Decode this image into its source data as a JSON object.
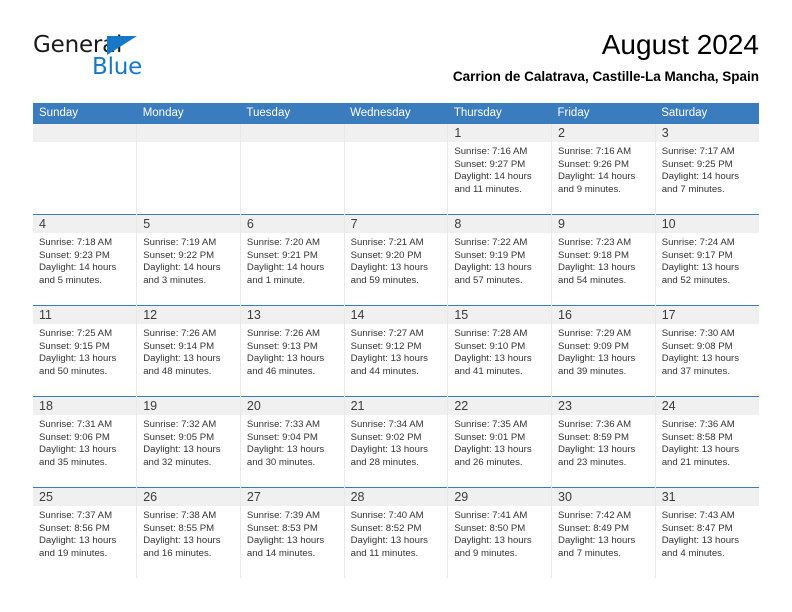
{
  "brand": {
    "name_top": "General",
    "name_bottom": "Blue",
    "triangle_color": "#1878c8",
    "text_color": "#1a1a1a"
  },
  "header": {
    "title": "August 2024",
    "subtitle": "Carrion de Calatrava, Castille-La Mancha, Spain"
  },
  "theme": {
    "header_bar": "#3a7cbd",
    "day_strip": "#f0f0f0",
    "row_divider": "#3a7cbd",
    "cell_text": "#333333"
  },
  "calendar": {
    "weekday_headers": [
      "Sunday",
      "Monday",
      "Tuesday",
      "Wednesday",
      "Thursday",
      "Friday",
      "Saturday"
    ],
    "labels": {
      "sunrise": "Sunrise:",
      "sunset": "Sunset:",
      "daylight": "Daylight:"
    },
    "weeks": [
      [
        {
          "day": "",
          "sunrise": "",
          "sunset": "",
          "daylight_1": "",
          "daylight_2": ""
        },
        {
          "day": "",
          "sunrise": "",
          "sunset": "",
          "daylight_1": "",
          "daylight_2": ""
        },
        {
          "day": "",
          "sunrise": "",
          "sunset": "",
          "daylight_1": "",
          "daylight_2": ""
        },
        {
          "day": "",
          "sunrise": "",
          "sunset": "",
          "daylight_1": "",
          "daylight_2": ""
        },
        {
          "day": "1",
          "sunrise": "Sunrise: 7:16 AM",
          "sunset": "Sunset: 9:27 PM",
          "daylight_1": "Daylight: 14 hours",
          "daylight_2": "and 11 minutes."
        },
        {
          "day": "2",
          "sunrise": "Sunrise: 7:16 AM",
          "sunset": "Sunset: 9:26 PM",
          "daylight_1": "Daylight: 14 hours",
          "daylight_2": "and 9 minutes."
        },
        {
          "day": "3",
          "sunrise": "Sunrise: 7:17 AM",
          "sunset": "Sunset: 9:25 PM",
          "daylight_1": "Daylight: 14 hours",
          "daylight_2": "and 7 minutes."
        }
      ],
      [
        {
          "day": "4",
          "sunrise": "Sunrise: 7:18 AM",
          "sunset": "Sunset: 9:23 PM",
          "daylight_1": "Daylight: 14 hours",
          "daylight_2": "and 5 minutes."
        },
        {
          "day": "5",
          "sunrise": "Sunrise: 7:19 AM",
          "sunset": "Sunset: 9:22 PM",
          "daylight_1": "Daylight: 14 hours",
          "daylight_2": "and 3 minutes."
        },
        {
          "day": "6",
          "sunrise": "Sunrise: 7:20 AM",
          "sunset": "Sunset: 9:21 PM",
          "daylight_1": "Daylight: 14 hours",
          "daylight_2": "and 1 minute."
        },
        {
          "day": "7",
          "sunrise": "Sunrise: 7:21 AM",
          "sunset": "Sunset: 9:20 PM",
          "daylight_1": "Daylight: 13 hours",
          "daylight_2": "and 59 minutes."
        },
        {
          "day": "8",
          "sunrise": "Sunrise: 7:22 AM",
          "sunset": "Sunset: 9:19 PM",
          "daylight_1": "Daylight: 13 hours",
          "daylight_2": "and 57 minutes."
        },
        {
          "day": "9",
          "sunrise": "Sunrise: 7:23 AM",
          "sunset": "Sunset: 9:18 PM",
          "daylight_1": "Daylight: 13 hours",
          "daylight_2": "and 54 minutes."
        },
        {
          "day": "10",
          "sunrise": "Sunrise: 7:24 AM",
          "sunset": "Sunset: 9:17 PM",
          "daylight_1": "Daylight: 13 hours",
          "daylight_2": "and 52 minutes."
        }
      ],
      [
        {
          "day": "11",
          "sunrise": "Sunrise: 7:25 AM",
          "sunset": "Sunset: 9:15 PM",
          "daylight_1": "Daylight: 13 hours",
          "daylight_2": "and 50 minutes."
        },
        {
          "day": "12",
          "sunrise": "Sunrise: 7:26 AM",
          "sunset": "Sunset: 9:14 PM",
          "daylight_1": "Daylight: 13 hours",
          "daylight_2": "and 48 minutes."
        },
        {
          "day": "13",
          "sunrise": "Sunrise: 7:26 AM",
          "sunset": "Sunset: 9:13 PM",
          "daylight_1": "Daylight: 13 hours",
          "daylight_2": "and 46 minutes."
        },
        {
          "day": "14",
          "sunrise": "Sunrise: 7:27 AM",
          "sunset": "Sunset: 9:12 PM",
          "daylight_1": "Daylight: 13 hours",
          "daylight_2": "and 44 minutes."
        },
        {
          "day": "15",
          "sunrise": "Sunrise: 7:28 AM",
          "sunset": "Sunset: 9:10 PM",
          "daylight_1": "Daylight: 13 hours",
          "daylight_2": "and 41 minutes."
        },
        {
          "day": "16",
          "sunrise": "Sunrise: 7:29 AM",
          "sunset": "Sunset: 9:09 PM",
          "daylight_1": "Daylight: 13 hours",
          "daylight_2": "and 39 minutes."
        },
        {
          "day": "17",
          "sunrise": "Sunrise: 7:30 AM",
          "sunset": "Sunset: 9:08 PM",
          "daylight_1": "Daylight: 13 hours",
          "daylight_2": "and 37 minutes."
        }
      ],
      [
        {
          "day": "18",
          "sunrise": "Sunrise: 7:31 AM",
          "sunset": "Sunset: 9:06 PM",
          "daylight_1": "Daylight: 13 hours",
          "daylight_2": "and 35 minutes."
        },
        {
          "day": "19",
          "sunrise": "Sunrise: 7:32 AM",
          "sunset": "Sunset: 9:05 PM",
          "daylight_1": "Daylight: 13 hours",
          "daylight_2": "and 32 minutes."
        },
        {
          "day": "20",
          "sunrise": "Sunrise: 7:33 AM",
          "sunset": "Sunset: 9:04 PM",
          "daylight_1": "Daylight: 13 hours",
          "daylight_2": "and 30 minutes."
        },
        {
          "day": "21",
          "sunrise": "Sunrise: 7:34 AM",
          "sunset": "Sunset: 9:02 PM",
          "daylight_1": "Daylight: 13 hours",
          "daylight_2": "and 28 minutes."
        },
        {
          "day": "22",
          "sunrise": "Sunrise: 7:35 AM",
          "sunset": "Sunset: 9:01 PM",
          "daylight_1": "Daylight: 13 hours",
          "daylight_2": "and 26 minutes."
        },
        {
          "day": "23",
          "sunrise": "Sunrise: 7:36 AM",
          "sunset": "Sunset: 8:59 PM",
          "daylight_1": "Daylight: 13 hours",
          "daylight_2": "and 23 minutes."
        },
        {
          "day": "24",
          "sunrise": "Sunrise: 7:36 AM",
          "sunset": "Sunset: 8:58 PM",
          "daylight_1": "Daylight: 13 hours",
          "daylight_2": "and 21 minutes."
        }
      ],
      [
        {
          "day": "25",
          "sunrise": "Sunrise: 7:37 AM",
          "sunset": "Sunset: 8:56 PM",
          "daylight_1": "Daylight: 13 hours",
          "daylight_2": "and 19 minutes."
        },
        {
          "day": "26",
          "sunrise": "Sunrise: 7:38 AM",
          "sunset": "Sunset: 8:55 PM",
          "daylight_1": "Daylight: 13 hours",
          "daylight_2": "and 16 minutes."
        },
        {
          "day": "27",
          "sunrise": "Sunrise: 7:39 AM",
          "sunset": "Sunset: 8:53 PM",
          "daylight_1": "Daylight: 13 hours",
          "daylight_2": "and 14 minutes."
        },
        {
          "day": "28",
          "sunrise": "Sunrise: 7:40 AM",
          "sunset": "Sunset: 8:52 PM",
          "daylight_1": "Daylight: 13 hours",
          "daylight_2": "and 11 minutes."
        },
        {
          "day": "29",
          "sunrise": "Sunrise: 7:41 AM",
          "sunset": "Sunset: 8:50 PM",
          "daylight_1": "Daylight: 13 hours",
          "daylight_2": "and 9 minutes."
        },
        {
          "day": "30",
          "sunrise": "Sunrise: 7:42 AM",
          "sunset": "Sunset: 8:49 PM",
          "daylight_1": "Daylight: 13 hours",
          "daylight_2": "and 7 minutes."
        },
        {
          "day": "31",
          "sunrise": "Sunrise: 7:43 AM",
          "sunset": "Sunset: 8:47 PM",
          "daylight_1": "Daylight: 13 hours",
          "daylight_2": "and 4 minutes."
        }
      ]
    ]
  }
}
